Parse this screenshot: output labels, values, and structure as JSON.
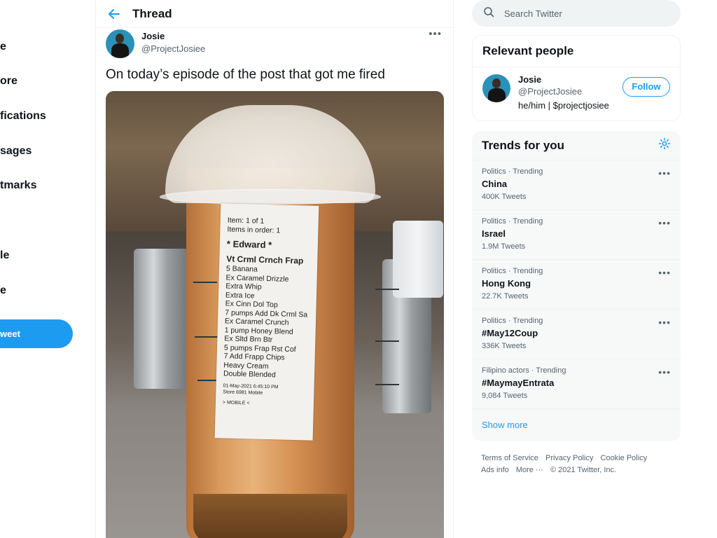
{
  "left_nav": {
    "items": [
      "e",
      "ore",
      "fications",
      "sages",
      "tmarks",
      "le",
      "e"
    ],
    "tweet_button": "weet"
  },
  "header": {
    "title": "Thread"
  },
  "tweet": {
    "author_name": "Josie",
    "author_handle": "@ProjectJosiee",
    "text": "On today’s episode of the post that got me fired",
    "receipt": {
      "item": "Item: 1 of 1",
      "items_in_order": "Items in order: 1",
      "customer": "* Edward *",
      "drink": "Vt Crml Crnch Frap",
      "mods": [
        "5 Banana",
        "Ex Caramel Drizzle",
        "Extra Whip",
        "Extra Ice",
        "Ex Cinn Dol Top",
        "7 pumps Add Dk Crml Sa",
        "Ex Caramel Crunch",
        "1 pump Honey Blend",
        "Ex Sltd Brn Btr",
        "5 pumps Frap Rst Cof",
        "7 Add Frapp Chips",
        "Heavy Cream",
        "Double Blended"
      ],
      "timestamp": "01-May-2021    6:45:10 PM",
      "store": "Store 6981    Mobile",
      "channel": "> MOBILE <"
    }
  },
  "search": {
    "placeholder": "Search Twitter"
  },
  "relevant_people": {
    "title": "Relevant people",
    "name": "Josie",
    "handle": "@ProjectJosiee",
    "bio": "he/him | $projectjosiee",
    "follow_label": "Follow"
  },
  "trends": {
    "title": "Trends for you",
    "items": [
      {
        "meta": "Politics · Trending",
        "name": "China",
        "count": "400K Tweets"
      },
      {
        "meta": "Politics · Trending",
        "name": "Israel",
        "count": "1.9M Tweets"
      },
      {
        "meta": "Politics · Trending",
        "name": "Hong Kong",
        "count": "22.7K Tweets"
      },
      {
        "meta": "Politics · Trending",
        "name": "#May12Coup",
        "count": "336K Tweets"
      },
      {
        "meta": "Filipino actors · Trending",
        "name": "#MaymayEntrata",
        "count": "9,084 Tweets"
      }
    ],
    "show_more": "Show more"
  },
  "footer": {
    "terms": "Terms of Service",
    "privacy": "Privacy Policy",
    "cookie": "Cookie Policy",
    "ads": "Ads info",
    "more": "More ···",
    "copyright": "© 2021 Twitter, Inc."
  },
  "colors": {
    "accent": "#1d9bf0",
    "text": "#0f1419",
    "muted": "#536471"
  }
}
